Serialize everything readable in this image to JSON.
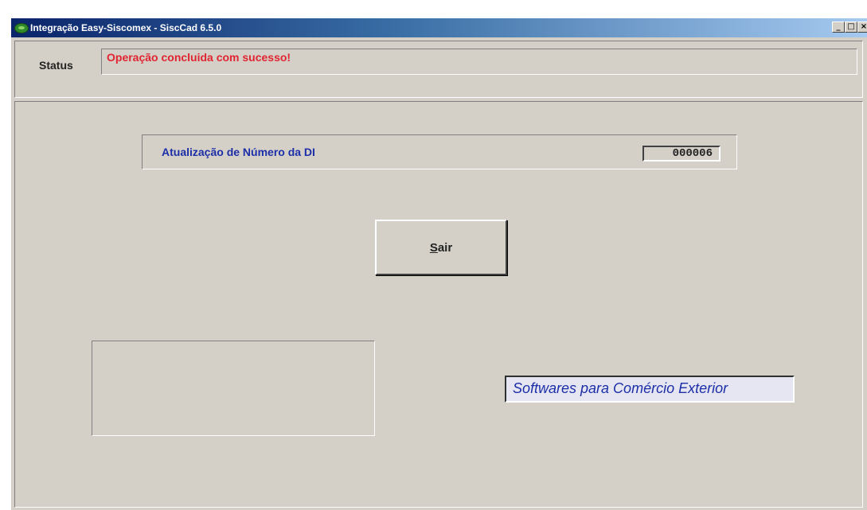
{
  "window": {
    "title": "Integração Easy-Siscomex - SiscCad 6.5.0",
    "minimize_glyph": "_",
    "maximize_glyph": "□",
    "close_glyph": "×"
  },
  "status": {
    "label": "Status",
    "message": "Operação concluida com sucesso!"
  },
  "di_update": {
    "label": "Atualização de Número da DI",
    "number": "000006"
  },
  "exit_button": {
    "accel": "S",
    "rest": "air"
  },
  "slogan": "Softwares para Comércio Exterior",
  "icons": {
    "app": "app-icon",
    "minimize": "minimize-icon",
    "maximize": "maximize-icon",
    "close": "close-icon"
  },
  "colors": {
    "window_bg": "#d4d0c8",
    "titlebar_start": "#0a246a",
    "titlebar_end": "#a6caf0",
    "status_text": "#e02430",
    "label_blue": "#1c2ea8"
  }
}
